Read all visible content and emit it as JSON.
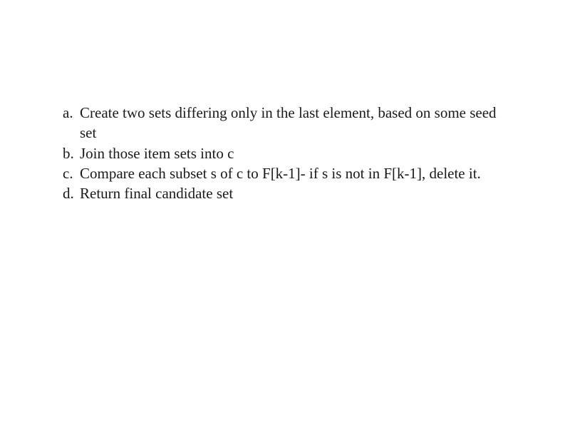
{
  "list": {
    "items": [
      {
        "marker": "a.",
        "text": "Create two sets differing only in the last element, based on some seed set"
      },
      {
        "marker": "b.",
        "text": "Join those item sets into c"
      },
      {
        "marker": "c.",
        "text": "Compare each subset s of c to F[k-1]- if s is not in F[k-1], delete it."
      },
      {
        "marker": "d.",
        "text": "Return final candidate set"
      }
    ]
  }
}
